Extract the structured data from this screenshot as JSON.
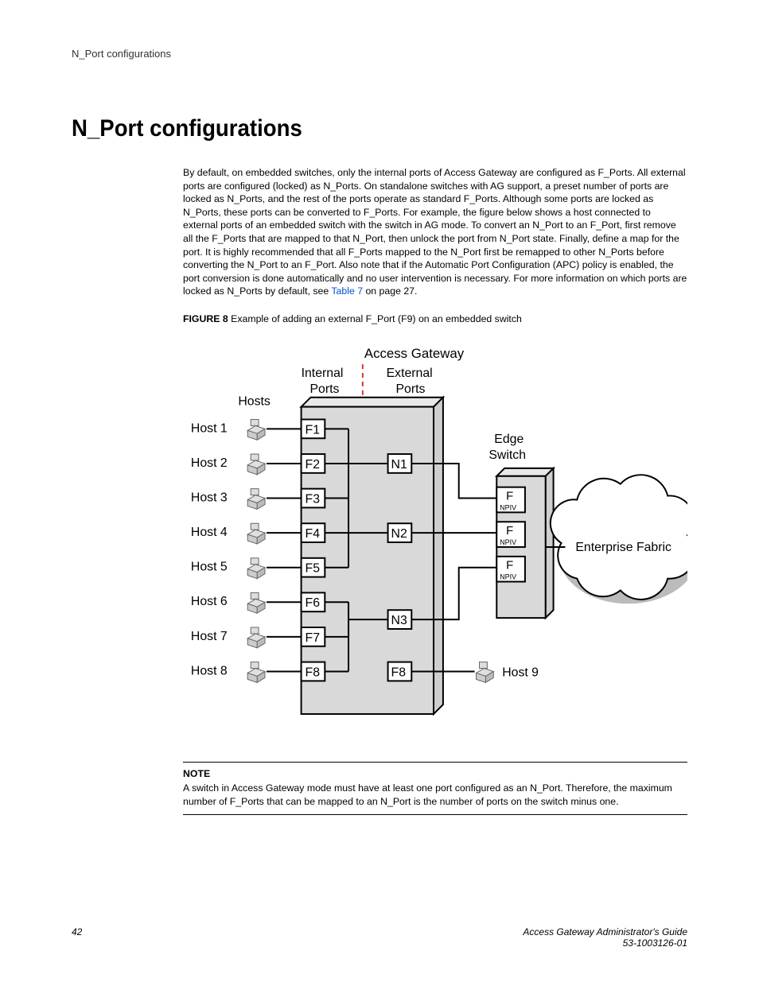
{
  "runningHead": "N_Port configurations",
  "title": "N_Port configurations",
  "paragraph": "By default, on embedded switches, only the internal ports of Access Gateway are configured as F_Ports. All external ports are configured (locked) as N_Ports. On standalone switches with AG support, a preset number of ports are locked as N_Ports, and the rest of the ports operate as standard F_Ports. Although some ports are locked as N_Ports, these ports can be converted to F_Ports. For example, the figure below shows a host connected to external ports of an embedded switch with the switch in AG mode. To convert an N_Port to an F_Port, first remove all the F_Ports that are mapped to that N_Port, then unlock the port from N_Port state. Finally, define a map for the port. It is highly recommended that all F_Ports mapped to the N_Port first be remapped to other N_Ports before converting the N_Port to an F_Port. Also note that if the Automatic Port Configuration (APC) policy is enabled, the port conversion is done automatically and no user intervention is necessary. For more information on which ports are locked as N_Ports by default, see ",
  "paragraphLink": "Table 7",
  "paragraphTail": " on page 27.",
  "figureLabel": "FIGURE 8",
  "figureCaption": " Example of adding an external F_Port (F9) on an embedded switch",
  "noteLabel": "NOTE",
  "noteBody": "A switch in Access Gateway mode must have at least one port configured as an N_Port. Therefore, the maximum number of F_Ports that can be mapped to an N_Port is the number of ports on the switch minus one.",
  "footerPage": "42",
  "footerTitle": "Access Gateway Administrator's Guide",
  "footerDoc": "53-1003126-01",
  "figure": {
    "topTitle": "Access Gateway",
    "leftHead": "Internal\nPorts",
    "rightHead": "External\nPorts",
    "hostsLabel": "Hosts",
    "hosts": [
      "Host 1",
      "Host 2",
      "Host 3",
      "Host 4",
      "Host 5",
      "Host 6",
      "Host 7",
      "Host 8"
    ],
    "fports": [
      "F1",
      "F2",
      "F3",
      "F4",
      "F5",
      "F6",
      "F7",
      "F8"
    ],
    "nports": [
      "N1",
      "N2",
      "N3"
    ],
    "extraF": "F8",
    "host9": "Host 9",
    "edge": "Edge\nSwitch",
    "npivBoxes": [
      "F",
      "F",
      "F"
    ],
    "npivSub": "NPIV",
    "fabric": "Enterprise Fabric"
  }
}
